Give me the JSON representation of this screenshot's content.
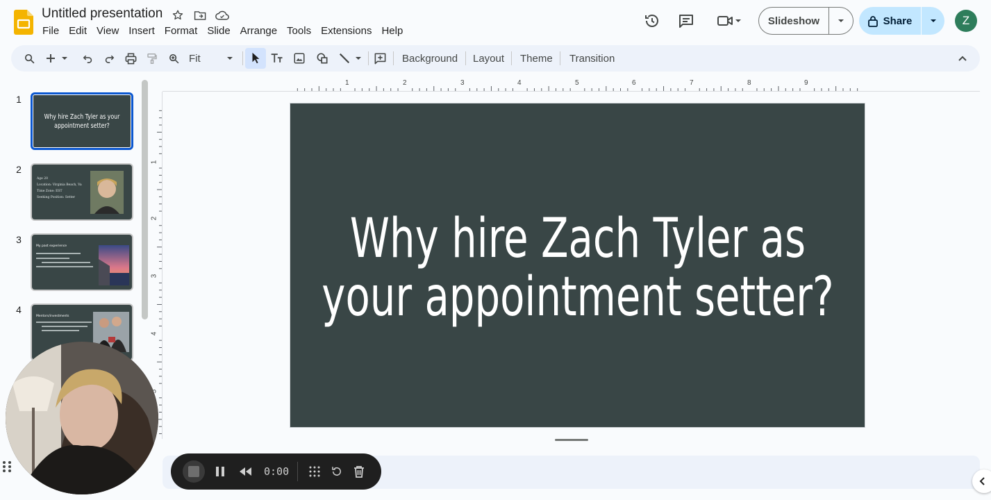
{
  "document": {
    "title": "Untitled presentation"
  },
  "menu": [
    "File",
    "Edit",
    "View",
    "Insert",
    "Format",
    "Slide",
    "Arrange",
    "Tools",
    "Extensions",
    "Help"
  ],
  "header": {
    "slideshow_label": "Slideshow",
    "share_label": "Share",
    "avatar_initial": "Z"
  },
  "toolbar": {
    "zoom_value": "Fit",
    "background_label": "Background",
    "layout_label": "Layout",
    "theme_label": "Theme",
    "transition_label": "Transition"
  },
  "ruler": {
    "horizontal": [
      "1",
      "2",
      "3",
      "4",
      "5",
      "6",
      "7",
      "8",
      "9"
    ],
    "vertical": [
      "1",
      "2",
      "3",
      "4",
      "5"
    ]
  },
  "filmstrip": {
    "slides": [
      {
        "number": "1",
        "title": "Why hire Zach Tyler as your appointment setter?"
      },
      {
        "number": "2",
        "lines": [
          "Age 20",
          "Location: Virginia Beach, Va",
          "Time Zone: EST",
          "Seeking Position: Setter"
        ]
      },
      {
        "number": "3",
        "title": "My past experience"
      },
      {
        "number": "4",
        "title": "Mentors/investments"
      }
    ]
  },
  "slide": {
    "title": "Why hire Zach Tyler as your appointment setter?"
  },
  "recorder": {
    "time": "0:00"
  },
  "colors": {
    "slide_bg": "#394646",
    "accent": "#0b57d0",
    "share_bg": "#c2e7ff",
    "toolbar_bg": "#edf2fa"
  }
}
